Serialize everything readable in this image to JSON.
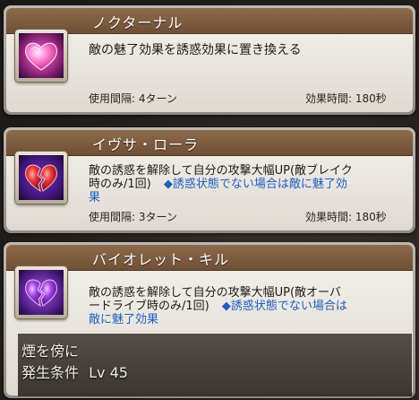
{
  "skills": [
    {
      "name": "ノクターナル",
      "icon": "pink-heart-icon",
      "description_line1": "敵の魅了効果を誘惑効果に置き換える",
      "cooldown": "使用間隔: 4ターン",
      "duration": "効果時間: 180秒"
    },
    {
      "name": "イヴサ・ローラ",
      "icon": "broken-red-heart-icon",
      "description_line1": "敵の誘惑を解除して自分の攻撃大幅UP(敵ブレイク",
      "description_line2a": "時のみ/1回)",
      "description_line2b": "◆誘惑状態でない場合は敵に魅了効",
      "description_line3": "果",
      "cooldown": "使用間隔: 3ターン",
      "duration": "効果時間: 180秒"
    },
    {
      "name": "バイオレット・キル",
      "icon": "broken-violet-heart-icon",
      "description_line1": "敵の誘惑を解除して自分の攻撃大幅UP(敵オーバ",
      "description_line2a": "ードライブ時のみ/1回)",
      "description_line2b": "◆誘惑状態でない場合は",
      "description_line3": "敵に魅了効果"
    }
  ],
  "unlock": {
    "label": "煙を傍に",
    "condition_label": "発生条件",
    "level": "Lv 45"
  },
  "colors": {
    "title_bar": "#7a5a3e",
    "highlight_text": "#1f5fbf"
  }
}
